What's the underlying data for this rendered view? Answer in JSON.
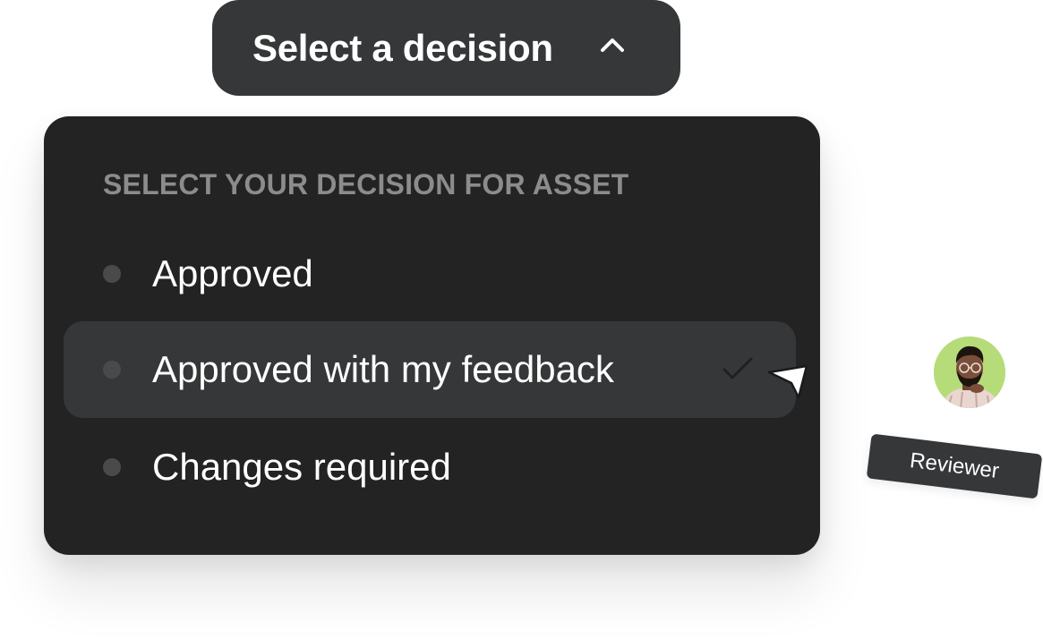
{
  "trigger": {
    "label": "Select a decision",
    "icon": "chevron-up-icon"
  },
  "panel": {
    "heading": "SELECT YOUR DECISION FOR ASSET",
    "options": [
      {
        "label": "Approved",
        "selected": false
      },
      {
        "label": "Approved with my feedback",
        "selected": true,
        "icon": "checkmark-icon"
      },
      {
        "label": "Changes required",
        "selected": false
      }
    ]
  },
  "reviewer": {
    "tag_label": "Reviewer",
    "avatar_bg": "#b6dc79"
  },
  "colors": {
    "button_bg": "#353738",
    "panel_bg": "#232323",
    "heading_text": "#8c8c8c",
    "option_text": "#ffffff",
    "highlight_bg": "#353738"
  }
}
